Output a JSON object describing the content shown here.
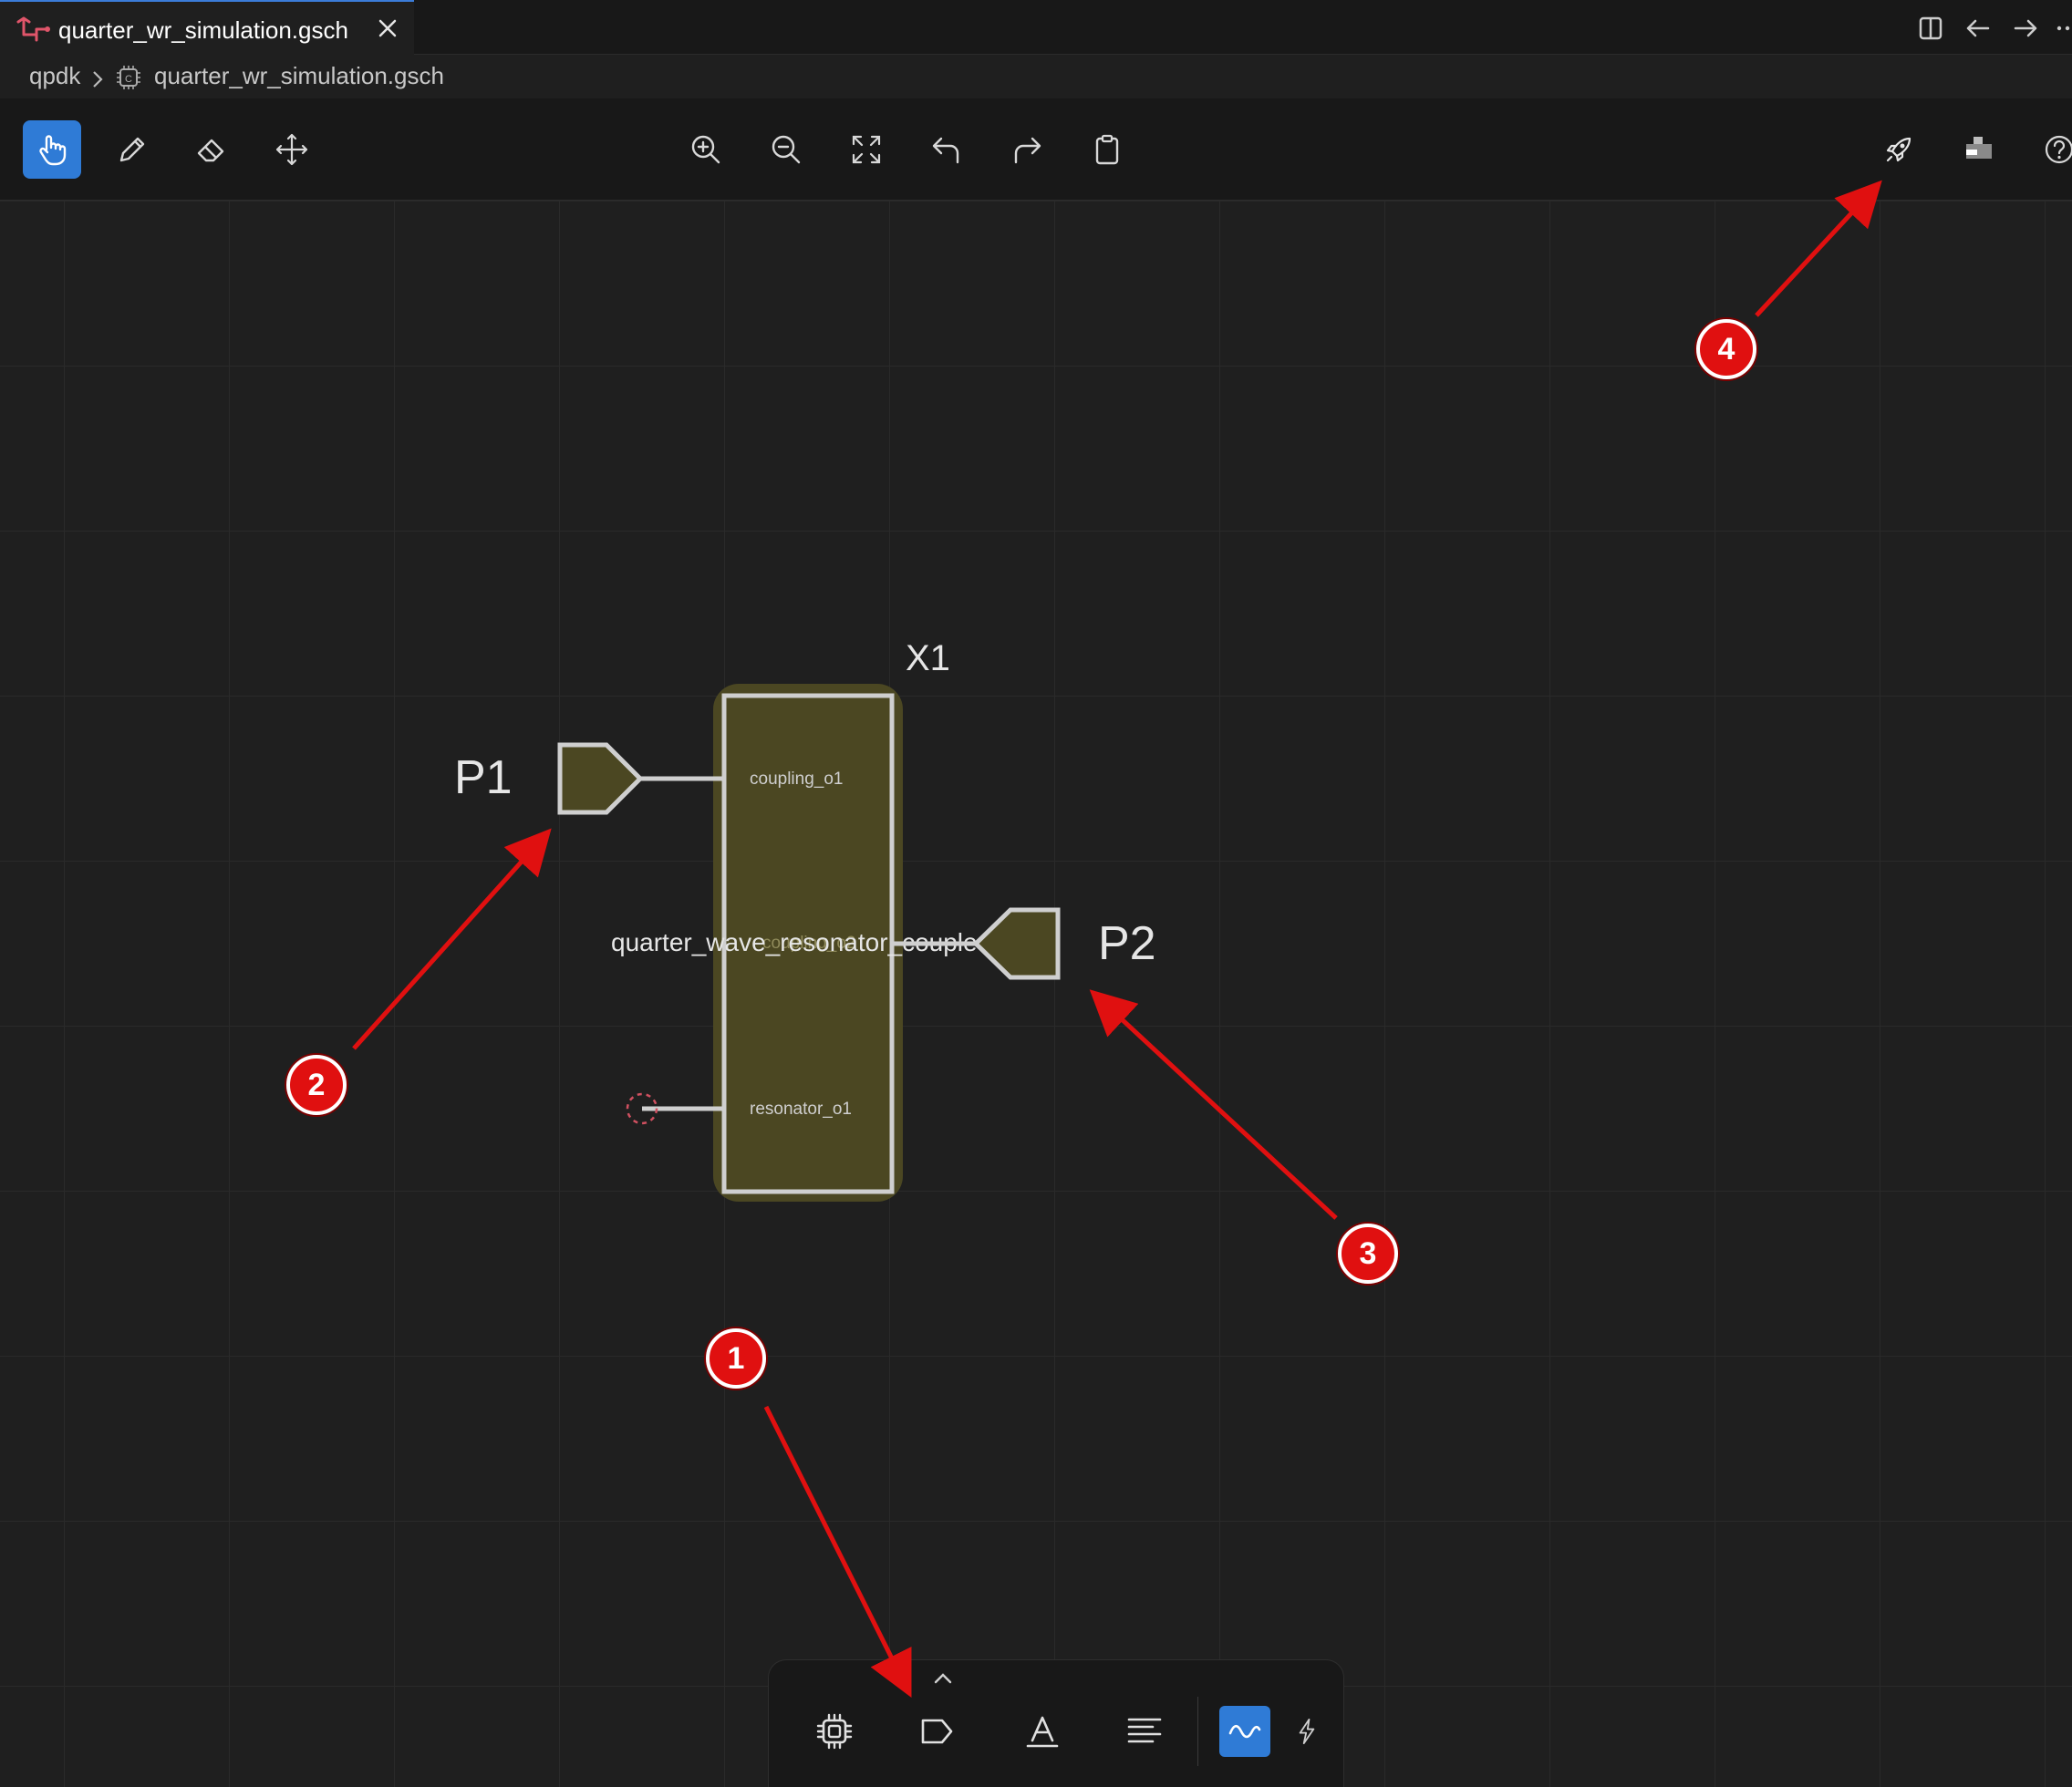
{
  "tab": {
    "title": "quarter_wr_simulation.gsch",
    "icon": "schematic-file-icon",
    "accent": "#3b7cd8"
  },
  "tabbar_actions": [
    "split-editor-icon",
    "back-arrow-icon",
    "forward-arrow-icon",
    "more-icon"
  ],
  "breadcrumb": {
    "root": "qpdk",
    "file": "quarter_wr_simulation.gsch"
  },
  "toolbar": {
    "left": [
      "pointer-tool",
      "pencil-tool",
      "eraser-tool",
      "move-tool"
    ],
    "active": "pointer-tool",
    "center": [
      "zoom-in",
      "zoom-out",
      "fit-view",
      "undo",
      "redo",
      "clipboard"
    ],
    "right": [
      "simulate-rocket",
      "component-panel",
      "help"
    ]
  },
  "schematic": {
    "component": {
      "ref": "X1",
      "name": "quarter_wave_resonator_coupled",
      "ports": [
        "coupling_o1",
        "coupling_o2",
        "resonator_o1"
      ],
      "fill": "#4b4722"
    },
    "port_left": "P1",
    "port_right": "P2"
  },
  "dock": {
    "items": [
      "component-chip",
      "port-tag",
      "text-label",
      "align-text",
      "waveform",
      "lightning"
    ],
    "active": "waveform"
  },
  "annotations": [
    "1",
    "2",
    "3",
    "4"
  ],
  "colors": {
    "annotation": "#e01010",
    "active_button": "#2f7bd6"
  }
}
